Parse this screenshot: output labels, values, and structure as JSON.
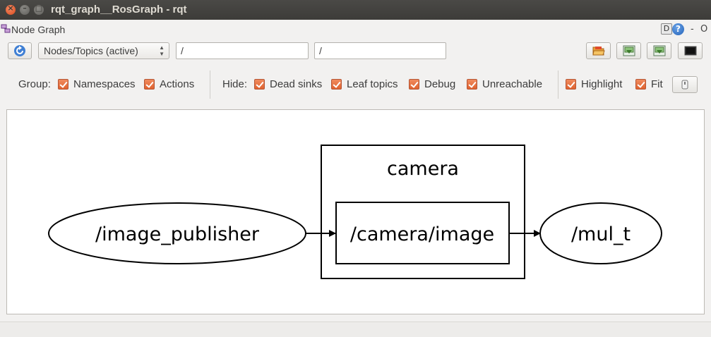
{
  "window": {
    "title": "rqt_graph__RosGraph - rqt"
  },
  "plugin_header": {
    "title": "Node Graph",
    "d_label": "D",
    "help_label": "?",
    "dash_label": "-",
    "o_label": "O"
  },
  "toolbar": {
    "graph_type_selected": "Nodes/Topics (active)",
    "node_filter_value": "/",
    "topic_filter_value": "/"
  },
  "options": {
    "group_label": "Group:",
    "namespaces_label": "Namespaces",
    "actions_label": "Actions",
    "hide_label": "Hide:",
    "dead_sinks_label": "Dead sinks",
    "leaf_topics_label": "Leaf topics",
    "debug_label": "Debug",
    "unreachable_label": "Unreachable",
    "highlight_label": "Highlight",
    "fit_label": "Fit"
  },
  "graph": {
    "nodes": {
      "image_publisher": "/image_publisher",
      "camera_image": "/camera/image",
      "mul_t": "/mul_t"
    },
    "namespace_group": "camera"
  },
  "colors": {
    "checkbox_accent": "#e0622f",
    "titlebar": "#3d3c39",
    "close_button": "#d9491e"
  }
}
